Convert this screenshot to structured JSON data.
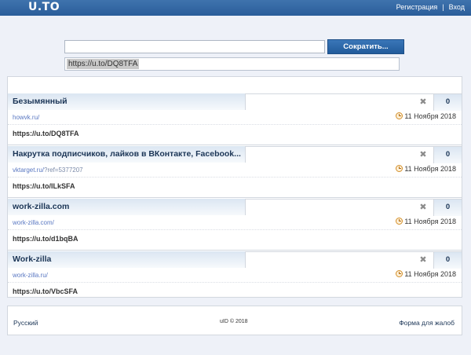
{
  "header": {
    "logo": "U.TO",
    "register_label": "Регистрация",
    "separator": "|",
    "login_label": "Вход"
  },
  "shortener": {
    "input_value": "",
    "button_label": "Сократить...",
    "result_value": "https://u.to/DQ8TFA"
  },
  "links": [
    {
      "title": "Безымянный",
      "source_domain": "howvk.ru/",
      "source_query": "",
      "date": "11 Ноября 2018",
      "count": "0",
      "short_url": "https://u.to/DQ8TFA"
    },
    {
      "title": "Накрутка подписчиков, лайков в ВКонтакте, Facebook...",
      "source_domain": "vktarget.ru/",
      "source_query": "?ref=5377207",
      "date": "11 Ноября 2018",
      "count": "0",
      "short_url": "https://u.to/ILkSFA"
    },
    {
      "title": "work-zilla.com",
      "source_domain": "work-zilla.com/",
      "source_query": "",
      "date": "11 Ноября 2018",
      "count": "0",
      "short_url": "https://u.to/d1bqBA"
    },
    {
      "title": "Work-zilla",
      "source_domain": "work-zilla.ru/",
      "source_query": "",
      "date": "11 Ноября 2018",
      "count": "0",
      "short_url": "https://u.to/VbcSFA"
    }
  ],
  "icons": {
    "delete": "close-icon",
    "date": "clock-icon"
  },
  "footer": {
    "language": "Русский",
    "copyright": "uID © 2018",
    "complaint_link": "Форма для жалоб"
  },
  "colors": {
    "header_bg": "#2f65a3",
    "button_bg": "#2a66a8",
    "title_text": "#1b3556",
    "link_text": "#5a78c2"
  }
}
